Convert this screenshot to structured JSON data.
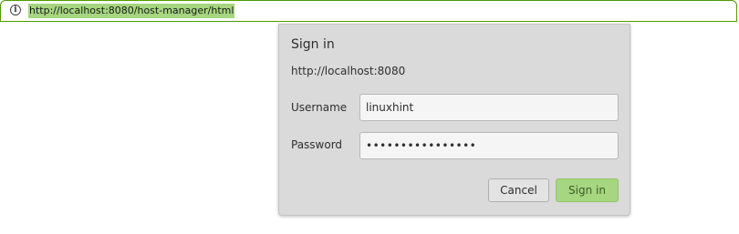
{
  "address_bar": {
    "url": "http://localhost:8080/host-manager/html",
    "info_icon": "info-icon"
  },
  "dialog": {
    "title": "Sign in",
    "host": "http://localhost:8080",
    "username_label": "Username",
    "username_value": "linuxhint",
    "password_label": "Password",
    "password_value": "••••••••••••••••",
    "cancel_label": "Cancel",
    "signin_label": "Sign in"
  },
  "colors": {
    "accent_green": "#a6d67f",
    "urlbar_border": "#4e9a06",
    "dialog_bg": "#dadada"
  }
}
